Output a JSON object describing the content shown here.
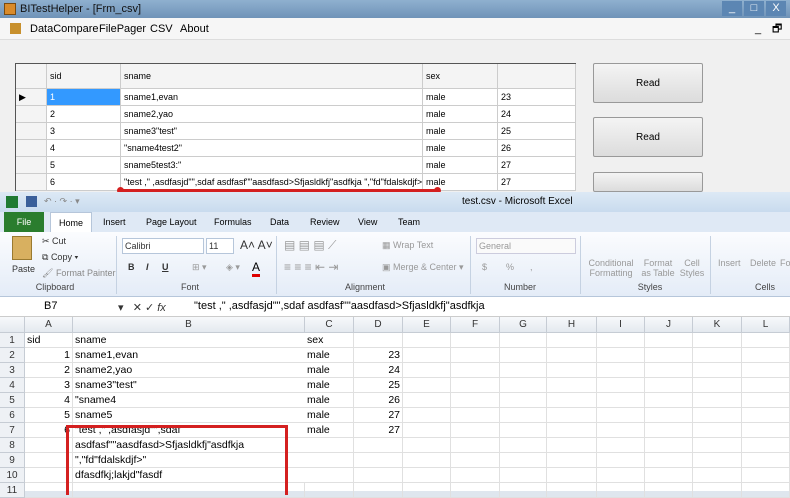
{
  "app": {
    "title": "BITestHelper - [Frm_csv]",
    "menu": [
      "DataCompare",
      "FilePager",
      "CSV",
      "About"
    ],
    "win_min": "_",
    "win_max": "□",
    "win_close": "X",
    "mdi_min": "_",
    "mdi_restore": "🗗"
  },
  "grid": {
    "columns": [
      "sid",
      "sname",
      "sex",
      ""
    ],
    "rows": [
      [
        "1",
        "sname1,evan",
        "male",
        "23"
      ],
      [
        "2",
        "sname2,yao",
        "male",
        "24"
      ],
      [
        "3",
        "sname3\"test\"",
        "male",
        "25"
      ],
      [
        "4",
        "\"sname4test2\"",
        "male",
        "26"
      ],
      [
        "5",
        "sname5test3:\"",
        "male",
        "27"
      ],
      [
        "6",
        "\"test ,\" ,asdfasjd\"\",sdaf asdfasf\"\"aasdfasd>Sfjasldkfj\"asdfkja \",\"fd\"fdalskdjf>\"dfa...",
        "male",
        "27"
      ]
    ]
  },
  "buttons": [
    "Read",
    "Read"
  ],
  "excel": {
    "title": "test.csv - Microsoft Excel",
    "tabs": [
      "File",
      "Home",
      "Insert",
      "Page Layout",
      "Formulas",
      "Data",
      "Review",
      "View",
      "Team"
    ],
    "ribbon": {
      "paste": "Paste",
      "cut": "Cut",
      "copy": "Copy",
      "format_painter": "Format Painter",
      "clipboard": "Clipboard",
      "font_name": "Calibri",
      "font_size": "11",
      "font": "Font",
      "wrap": "Wrap Text",
      "merge": "Merge & Center",
      "alignment": "Alignment",
      "number_format": "General",
      "number": "Number",
      "cond": "Conditional Formatting",
      "fmt_table": "Format as Table",
      "cell_styles": "Cell Styles",
      "styles": "Styles",
      "insert": "Insert",
      "delete": "Delete",
      "format": "Fo",
      "cells": "Cells",
      "bold": "B",
      "italic": "I",
      "underline": "U",
      "dollar": "$",
      "percent": "%",
      "comma": ","
    },
    "name_box": "B7",
    "formula": "\"test ,\" ,asdfasjd\"\",sdaf asdfasf\"\"aasdfasd>Sfjasldkfj\"asdfkja",
    "col_headers": [
      "A",
      "B",
      "C",
      "D",
      "E",
      "F",
      "G",
      "H",
      "I",
      "J",
      "K",
      "L"
    ],
    "rows": [
      [
        "sid",
        "sname",
        "sex",
        ""
      ],
      [
        "1",
        "sname1,evan",
        "male",
        "23"
      ],
      [
        "2",
        "sname2,yao",
        "male",
        "24"
      ],
      [
        "3",
        "sname3\"test\"",
        "male",
        "25"
      ],
      [
        "4",
        "\"sname4",
        "male",
        "26"
      ],
      [
        "5",
        "sname5",
        "male",
        "27"
      ],
      [
        "6",
        "\"test ,\" ,asdfasjd\"\",sdaf",
        "male",
        "27"
      ],
      [
        "",
        "asdfasf\"\"aasdfasd>Sfjasldkfj\"asdfkja",
        "",
        ""
      ],
      [
        "",
        "\",\"fd\"fdalskdjf>\"",
        "",
        ""
      ],
      [
        "",
        "dfasdfkj;lakjd\"fasdf",
        "",
        ""
      ]
    ]
  },
  "colors": {
    "highlight": "#d42020",
    "excel_file_tab": "#2a7d2e",
    "selection": "#3399ff"
  }
}
